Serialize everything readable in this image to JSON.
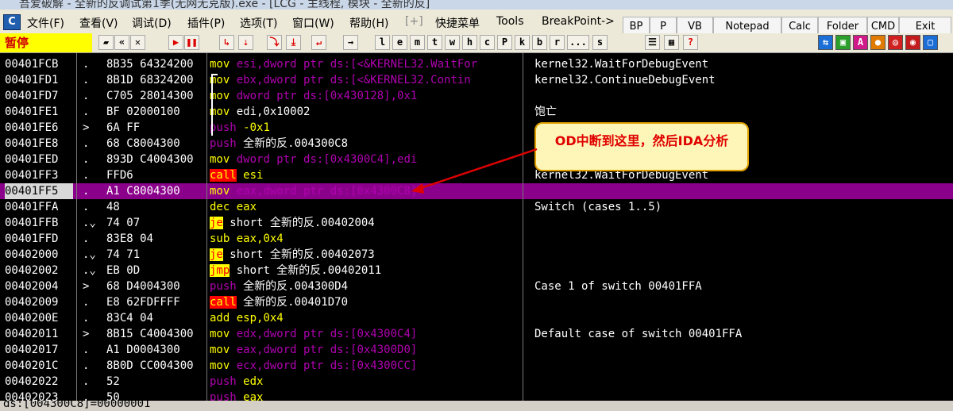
{
  "window": {
    "title": "吾爱破解 - 全新的反调试第1季(无网无克版).exe - [LCG - 主线程, 模块 - 全新的反]"
  },
  "menu": {
    "app_icon": "C",
    "items": [
      "文件(F)",
      "查看(V)",
      "调试(D)",
      "插件(P)",
      "选项(T)",
      "窗口(W)",
      "帮助(H)",
      "[+]",
      "快捷菜单",
      "Tools",
      "BreakPoint->"
    ]
  },
  "quick_buttons": [
    "BP",
    "P",
    "VB",
    "Notepad",
    "Calc",
    "Folder",
    "CMD",
    "Exit"
  ],
  "toolbar": {
    "status": "暂停",
    "letters": [
      "l",
      "e",
      "m",
      "t",
      "w",
      "h",
      "c",
      "P",
      "k",
      "b",
      "r",
      "...",
      "s"
    ]
  },
  "rows": [
    {
      "addr": "00401FCB",
      "mark": ".",
      "hex": "8B35 64324200",
      "mn": "mov",
      "cls": "mov",
      "ops": "esi,dword ptr ds:[<&KERNEL32.WaitFor",
      "opcls": "op-mag",
      "cmt": "kernel32.WaitForDebugEvent"
    },
    {
      "addr": "00401FD1",
      "mark": ".",
      "hex": "8B1D 68324200",
      "mn": "mov",
      "cls": "mov",
      "ops": "ebx,dword ptr ds:[<&KERNEL32.Contin",
      "opcls": "op-mag",
      "cmt": "kernel32.ContinueDebugEvent"
    },
    {
      "addr": "00401FD7",
      "mark": ".",
      "hex": "C705 28014300",
      "mn": "mov",
      "cls": "mov",
      "ops": "dword ptr ds:[0x430128],0x1",
      "opcls": "op-mag",
      "cmt": ""
    },
    {
      "addr": "00401FE1",
      "mark": ".",
      "hex": "BF 02000100",
      "mn": "mov",
      "cls": "mov",
      "ops": "edi,0x10002",
      "opcls": "op-wht",
      "cmt": "饱亡"
    },
    {
      "addr": "00401FE6",
      "mark": ">",
      "hex": "6A FF",
      "mn": "push",
      "cls": "push",
      "ops": "-0x1",
      "opcls": "op-yel",
      "cmt": ""
    },
    {
      "addr": "00401FE8",
      "mark": ".",
      "hex": "68 C8004300",
      "mn": "push",
      "cls": "push",
      "ops": "全新的反.004300C8",
      "opcls": "op-wht",
      "cmt": ""
    },
    {
      "addr": "00401FED",
      "mark": ".",
      "hex": "893D C4004300",
      "mn": "mov",
      "cls": "mov",
      "ops": "dword ptr ds:[0x4300C4],edi",
      "opcls": "op-mag",
      "cmt": ""
    },
    {
      "addr": "00401FF3",
      "mark": ".",
      "hex": "FFD6",
      "mn": "call",
      "cls": "call",
      "ops": "esi",
      "opcls": "op-yel",
      "cmt": "kernel32.WaitForDebugEvent"
    },
    {
      "addr": "00401FF5",
      "mark": ".",
      "hex": "A1 C8004300",
      "mn": "mov",
      "cls": "mov",
      "ops": "eax,dword ptr ds:[0x4300C8]",
      "opcls": "op-mag",
      "cmt": ""
    },
    {
      "addr": "00401FFA",
      "mark": ".",
      "hex": "48",
      "mn": "dec",
      "cls": "mov",
      "ops": "eax",
      "opcls": "op-yel",
      "cmt": "Switch (cases 1..5)"
    },
    {
      "addr": "00401FFB",
      "mark": ".⌄",
      "hex": "74 07",
      "mn": "je",
      "cls": "jmp",
      "ops": "short 全新的反.00402004",
      "opcls": "op-wht",
      "cmt": ""
    },
    {
      "addr": "00401FFD",
      "mark": ".",
      "hex": "83E8 04",
      "mn": "sub",
      "cls": "mov",
      "ops": "eax,0x4",
      "opcls": "op-yel",
      "cmt": ""
    },
    {
      "addr": "00402000",
      "mark": ".⌄",
      "hex": "74 71",
      "mn": "je",
      "cls": "jmp",
      "ops": "short 全新的反.00402073",
      "opcls": "op-wht",
      "cmt": ""
    },
    {
      "addr": "00402002",
      "mark": ".⌄",
      "hex": "EB 0D",
      "mn": "jmp",
      "cls": "jmp",
      "ops": "short 全新的反.00402011",
      "opcls": "op-wht",
      "cmt": ""
    },
    {
      "addr": "00402004",
      "mark": ">",
      "hex": "68 D4004300",
      "mn": "push",
      "cls": "push",
      "ops": "全新的反.004300D4",
      "opcls": "op-wht",
      "cmt": "Case 1 of switch 00401FFA"
    },
    {
      "addr": "00402009",
      "mark": ".",
      "hex": "E8 62FDFFFF",
      "mn": "call",
      "cls": "call",
      "ops": "全新的反.00401D70",
      "opcls": "op-wht",
      "cmt": ""
    },
    {
      "addr": "0040200E",
      "mark": ".",
      "hex": "83C4 04",
      "mn": "add",
      "cls": "mov",
      "ops": "esp,0x4",
      "opcls": "op-yel",
      "cmt": ""
    },
    {
      "addr": "00402011",
      "mark": ">",
      "hex": "8B15 C4004300",
      "mn": "mov",
      "cls": "mov",
      "ops": "edx,dword ptr ds:[0x4300C4]",
      "opcls": "op-mag",
      "cmt": "Default case of switch 00401FFA"
    },
    {
      "addr": "00402017",
      "mark": ".",
      "hex": "A1 D0004300",
      "mn": "mov",
      "cls": "mov",
      "ops": "eax,dword ptr ds:[0x4300D0]",
      "opcls": "op-mag",
      "cmt": ""
    },
    {
      "addr": "0040201C",
      "mark": ".",
      "hex": "8B0D CC004300",
      "mn": "mov",
      "cls": "mov",
      "ops": "ecx,dword ptr ds:[0x4300CC]",
      "opcls": "op-mag",
      "cmt": ""
    },
    {
      "addr": "00402022",
      "mark": ".",
      "hex": "52",
      "mn": "push",
      "cls": "push",
      "ops": "edx",
      "opcls": "op-yel",
      "cmt": ""
    },
    {
      "addr": "00402023",
      "mark": ".",
      "hex": "50",
      "mn": "push",
      "cls": "push",
      "ops": "eax",
      "opcls": "op-yel",
      "cmt": ""
    }
  ],
  "current_row_index": 8,
  "annotation": "OD中断到这里，然后IDA分析",
  "status": "ds:[004300C8]=00000001",
  "colors": {
    "current_line": "#8b008b",
    "pause_bg": "#ffff00",
    "callout_text": "#e00000"
  }
}
